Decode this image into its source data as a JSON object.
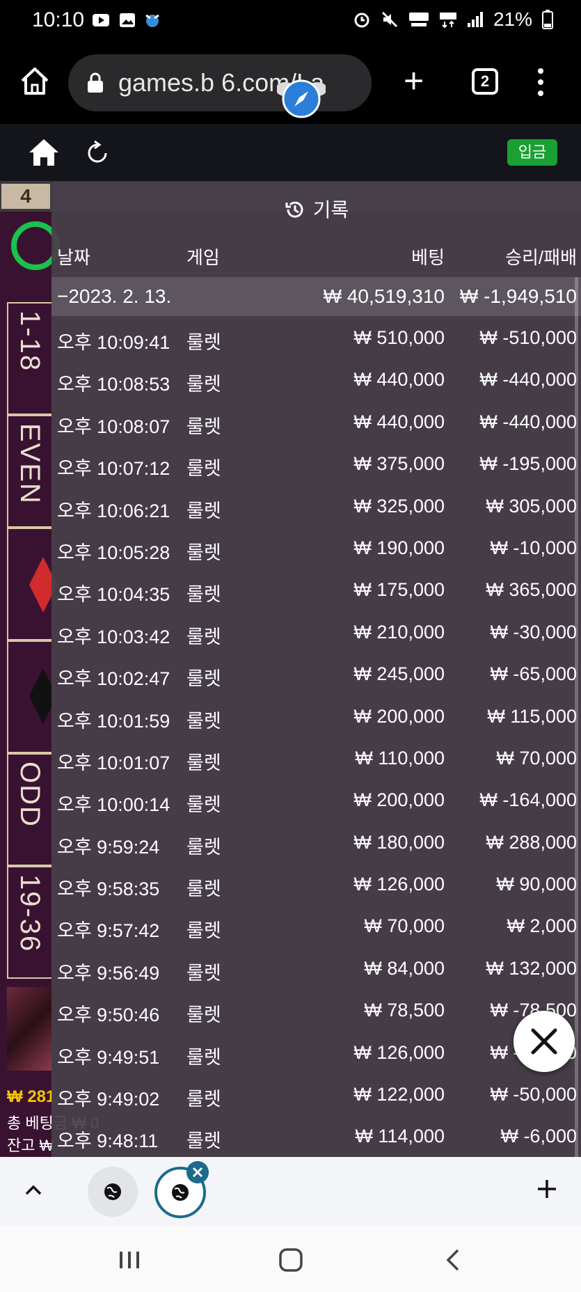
{
  "status_bar": {
    "time": "10:10",
    "battery": "21%"
  },
  "browser": {
    "url": "games.b   6.com/La",
    "tab_count": "2"
  },
  "site": {
    "deposit_label": "입금"
  },
  "game": {
    "score_first": "4",
    "bet_labels": [
      "1-18",
      "EVEN",
      "ODD",
      "19-36"
    ],
    "balance_partial": "₩ 281",
    "total_bet_partial": "총 베팅금 ₩ 0",
    "balance_label_partial": "잔고 ₩"
  },
  "history": {
    "title": "기록",
    "columns": {
      "date": "날짜",
      "game": "게임",
      "bet": "베팅",
      "winloss": "승리/패배"
    },
    "date_group": {
      "date": "−2023. 2. 13.",
      "bet_total": "₩ 40,519,310",
      "winloss_total": "₩ -1,949,510"
    },
    "rows": [
      {
        "time": "오후 10:09:41",
        "game": "룰렛",
        "bet": "₩ 510,000",
        "winloss": "₩ -510,000"
      },
      {
        "time": "오후 10:08:53",
        "game": "룰렛",
        "bet": "₩ 440,000",
        "winloss": "₩ -440,000"
      },
      {
        "time": "오후 10:08:07",
        "game": "룰렛",
        "bet": "₩ 440,000",
        "winloss": "₩ -440,000"
      },
      {
        "time": "오후 10:07:12",
        "game": "룰렛",
        "bet": "₩ 375,000",
        "winloss": "₩ -195,000"
      },
      {
        "time": "오후 10:06:21",
        "game": "룰렛",
        "bet": "₩ 325,000",
        "winloss": "₩ 305,000"
      },
      {
        "time": "오후 10:05:28",
        "game": "룰렛",
        "bet": "₩ 190,000",
        "winloss": "₩ -10,000"
      },
      {
        "time": "오후 10:04:35",
        "game": "룰렛",
        "bet": "₩ 175,000",
        "winloss": "₩ 365,000"
      },
      {
        "time": "오후 10:03:42",
        "game": "룰렛",
        "bet": "₩ 210,000",
        "winloss": "₩ -30,000"
      },
      {
        "time": "오후 10:02:47",
        "game": "룰렛",
        "bet": "₩ 245,000",
        "winloss": "₩ -65,000"
      },
      {
        "time": "오후 10:01:59",
        "game": "룰렛",
        "bet": "₩ 200,000",
        "winloss": "₩ 115,000"
      },
      {
        "time": "오후 10:01:07",
        "game": "룰렛",
        "bet": "₩ 110,000",
        "winloss": "₩ 70,000"
      },
      {
        "time": "오후 10:00:14",
        "game": "룰렛",
        "bet": "₩ 200,000",
        "winloss": "₩ -164,000"
      },
      {
        "time": "오후 9:59:24",
        "game": "룰렛",
        "bet": "₩ 180,000",
        "winloss": "₩ 288,000"
      },
      {
        "time": "오후 9:58:35",
        "game": "룰렛",
        "bet": "₩ 126,000",
        "winloss": "₩ 90,000"
      },
      {
        "time": "오후 9:57:42",
        "game": "룰렛",
        "bet": "₩ 70,000",
        "winloss": "₩ 2,000"
      },
      {
        "time": "오후 9:56:49",
        "game": "룰렛",
        "bet": "₩ 84,000",
        "winloss": "₩ 132,000"
      },
      {
        "time": "오후 9:50:46",
        "game": "룰렛",
        "bet": "₩ 78,500",
        "winloss": "₩ -78,500"
      },
      {
        "time": "오후 9:49:51",
        "game": "룰렛",
        "bet": "₩ 126,000",
        "winloss": "₩ -90,000"
      },
      {
        "time": "오후 9:49:02",
        "game": "룰렛",
        "bet": "₩ 122,000",
        "winloss": "₩ -50,000"
      },
      {
        "time": "오후 9:48:11",
        "game": "룰렛",
        "bet": "₩ 114,000",
        "winloss": "₩ -6,000"
      }
    ]
  },
  "colors": {
    "deposit_button": "#1aa033",
    "timer_ring": "#19c24b",
    "tab_accent": "#1d6a8a"
  }
}
